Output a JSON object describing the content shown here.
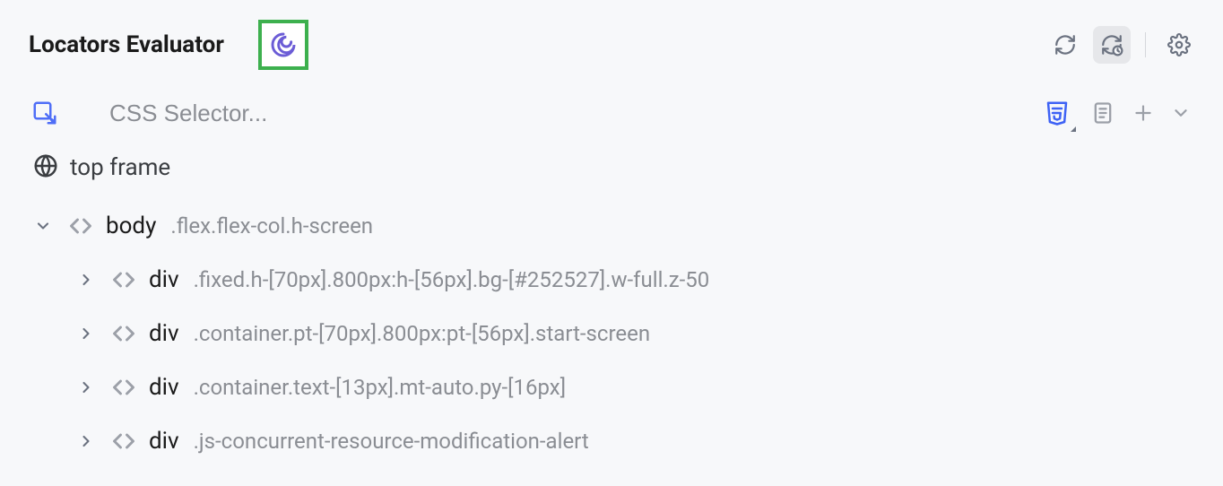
{
  "header": {
    "title": "Locators Evaluator"
  },
  "search": {
    "placeholder": "CSS Selector..."
  },
  "frame": {
    "label": "top frame"
  },
  "tree": [
    {
      "tag": "body",
      "classes": ".flex.flex-col.h-screen",
      "expanded": true,
      "level": 0
    },
    {
      "tag": "div",
      "classes": ".fixed.h-[70px].800px:h-[56px].bg-[#252527].w-full.z-50",
      "expanded": false,
      "level": 1
    },
    {
      "tag": "div",
      "classes": ".container.pt-[70px].800px:pt-[56px].start-screen",
      "expanded": false,
      "level": 1
    },
    {
      "tag": "div",
      "classes": ".container.text-[13px].mt-auto.py-[16px]",
      "expanded": false,
      "level": 1
    },
    {
      "tag": "div",
      "classes": ".js-concurrent-resource-modification-alert",
      "expanded": false,
      "level": 1
    }
  ]
}
